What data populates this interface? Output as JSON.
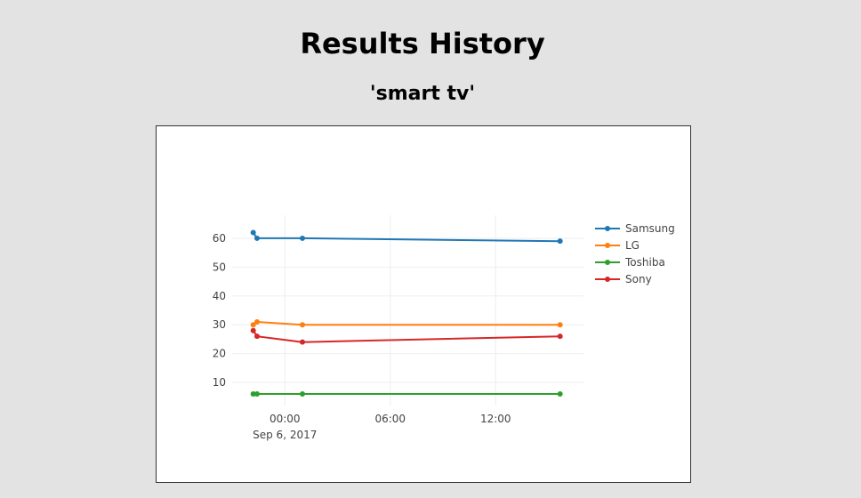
{
  "header": {
    "title": "Results History",
    "subtitle": "'smart tv'"
  },
  "chart_data": {
    "type": "line",
    "x_type": "datetime",
    "xlim": [
      "2017-09-05T21:00",
      "2017-09-06T17:00"
    ],
    "ylim": [
      2,
      68
    ],
    "x_ticks": [
      {
        "value": "2017-09-06T00:00",
        "label": "00:00",
        "sublabel": "Sep 6, 2017"
      },
      {
        "value": "2017-09-06T06:00",
        "label": "06:00",
        "sublabel": ""
      },
      {
        "value": "2017-09-06T12:00",
        "label": "12:00",
        "sublabel": ""
      }
    ],
    "y_ticks": [
      10,
      20,
      30,
      40,
      50,
      60
    ],
    "grid": true,
    "legend_position": "right",
    "x": [
      "2017-09-05T22:12",
      "2017-09-05T22:25",
      "2017-09-06T01:00",
      "2017-09-06T15:40"
    ],
    "series": [
      {
        "name": "Samsung",
        "color": "#1f77b4",
        "values": [
          62,
          60,
          60,
          59
        ]
      },
      {
        "name": "LG",
        "color": "#ff7f0e",
        "values": [
          30,
          31,
          30,
          30
        ]
      },
      {
        "name": "Toshiba",
        "color": "#2ca02c",
        "values": [
          6,
          6,
          6,
          6
        ]
      },
      {
        "name": "Sony",
        "color": "#d62728",
        "values": [
          28,
          26,
          24,
          26
        ]
      }
    ]
  }
}
